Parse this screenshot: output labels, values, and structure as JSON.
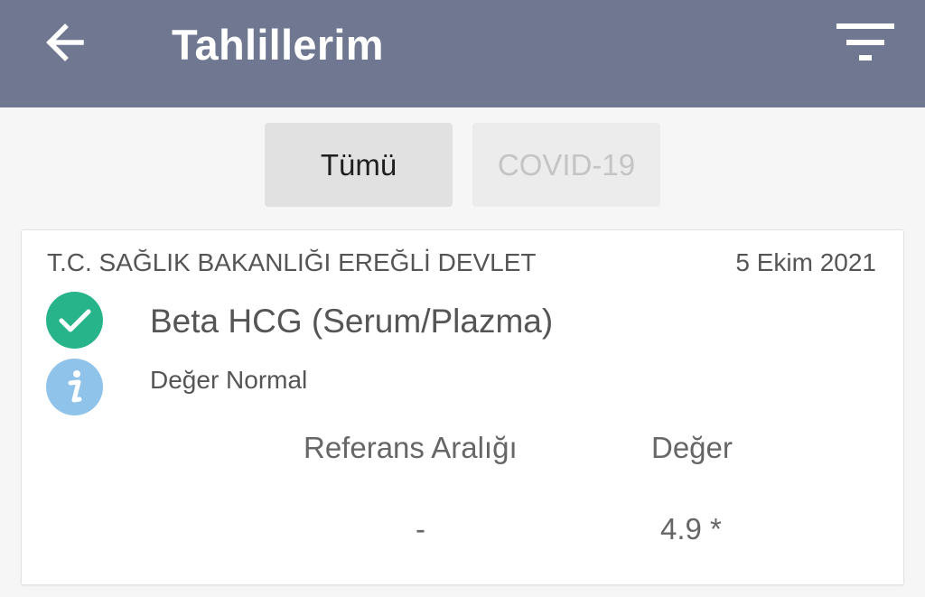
{
  "header": {
    "title": "Tahlillerim",
    "back_icon": "arrow-left-icon",
    "filter_icon": "filter-icon"
  },
  "tabs": [
    {
      "label": "Tümü",
      "selected": true
    },
    {
      "label": "COVID-19",
      "selected": false
    }
  ],
  "result_card": {
    "institution": "T.C. SAĞLIK BAKANLIĞI EREĞLİ DEVLET",
    "date": "5 Ekim 2021",
    "test_name": "Beta HCG (Serum/Plazma)",
    "status": "Değer Normal",
    "status_icon": "check-circle-icon",
    "info_icon": "info-icon",
    "reference_header": "Referans Aralığı",
    "value_header": "Değer",
    "reference_value": "-",
    "value": "4.9 *"
  },
  "colors": {
    "appbar": "#6f7791",
    "check": "#28b48a",
    "info": "#8fc3ea"
  }
}
